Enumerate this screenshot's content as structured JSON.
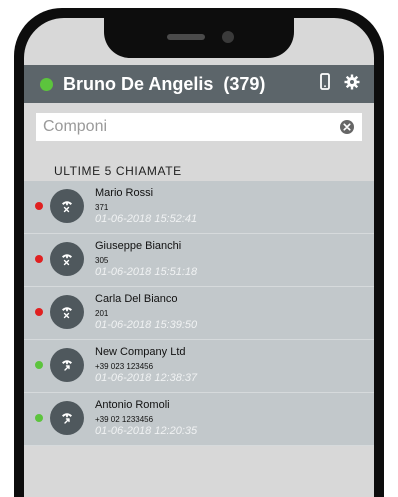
{
  "header": {
    "user_name": "Bruno De Angelis",
    "extension": "(379)",
    "status_color": "#5cc43d",
    "icons": [
      "phone-device-icon",
      "gear-icon"
    ]
  },
  "search": {
    "placeholder": "Componi",
    "value": ""
  },
  "recent_calls": {
    "title": "ULTIME 5 CHIAMATE",
    "items": [
      {
        "name": "Mario Rossi",
        "number": "371",
        "datetime": "01-06-2018 15:52:41",
        "status": "missed",
        "dot_color": "#e02020"
      },
      {
        "name": "Giuseppe Bianchi",
        "number": "305",
        "datetime": "01-06-2018 15:51:18",
        "status": "missed",
        "dot_color": "#e02020"
      },
      {
        "name": "Carla Del Bianco",
        "number": "201",
        "datetime": "01-06-2018 15:39:50",
        "status": "missed",
        "dot_color": "#e02020"
      },
      {
        "name": "New Company Ltd",
        "number": "+39 023 123456",
        "datetime": "01-06-2018 12:38:37",
        "status": "answered",
        "dot_color": "#5cc43d"
      },
      {
        "name": "Antonio Romoli",
        "number": "+39 02 1233456",
        "datetime": "01-06-2018 12:20:35",
        "status": "answered",
        "dot_color": "#5cc43d"
      }
    ]
  }
}
